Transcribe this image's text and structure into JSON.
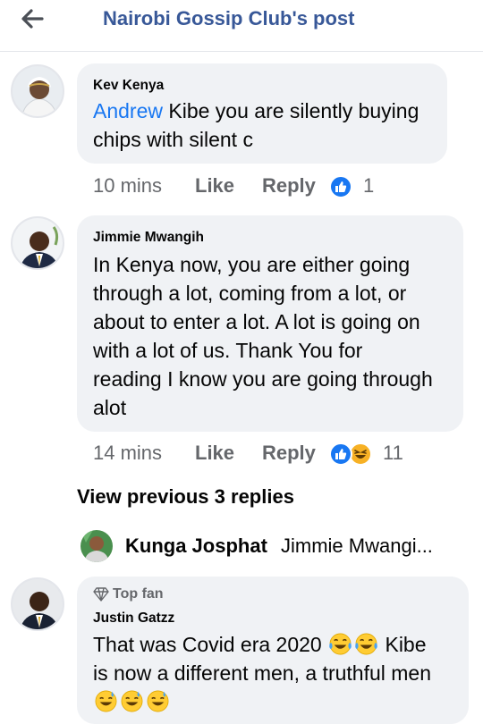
{
  "header": {
    "title": "Nairobi Gossip Club's post"
  },
  "comments": [
    {
      "author": "Kev Kenya",
      "mention": "Andrew",
      "text_line1": " Kibe you are silently buying",
      "text_line2": "chips with silent c",
      "time": "10 mins",
      "like_label": "Like",
      "reply_label": "Reply",
      "reaction_count": "1",
      "reactions": [
        "like-icon"
      ]
    },
    {
      "author": "Jimmie Mwangih",
      "text_lines": [
        "In Kenya now, you are either going",
        "through a lot, coming from a lot, or",
        "about to enter a lot. A lot is going on",
        "with a lot of us. Thank You for",
        "reading I know you are going through",
        "alot"
      ],
      "time": "14 mins",
      "like_label": "Like",
      "reply_label": "Reply",
      "reaction_count": "11",
      "reactions": [
        "like-icon",
        "haha-icon"
      ]
    }
  ],
  "view_previous": "View previous 3 replies",
  "latest_reply": {
    "author": "Kunga Josphat",
    "preview": "Jimmie Mwangi..."
  },
  "third_comment": {
    "badge": "Top fan",
    "author": "Justin Gatzz",
    "line1_a": "That was Covid era 2020",
    "line1_b": "Kibe",
    "line2": "is now a different men, a truthful men"
  },
  "colors": {
    "brand_blue": "#1877f2",
    "header_title": "#385898",
    "bubble_bg": "#f0f2f5",
    "meta_gray": "#65676b"
  }
}
